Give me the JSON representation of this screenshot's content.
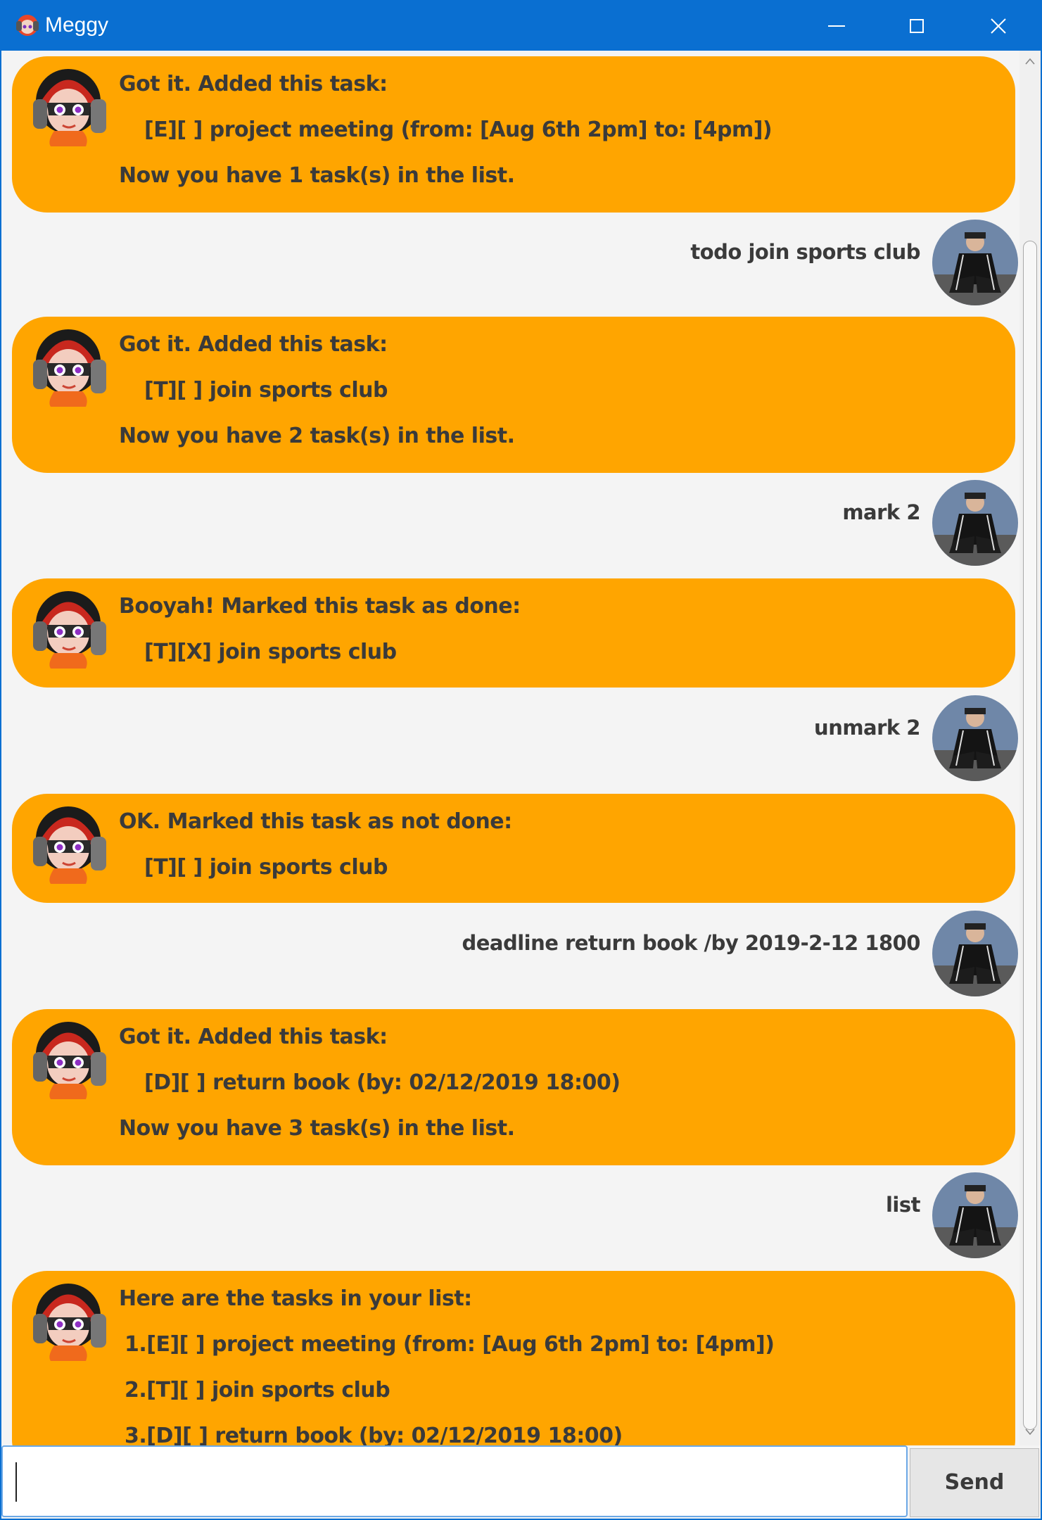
{
  "window": {
    "title": "Meggy"
  },
  "colors": {
    "titlebar": "#0a6fd1",
    "bot_bubble": "#ffa500",
    "background": "#f4f4f4",
    "text": "#3a3a3a"
  },
  "messages": [
    {
      "sender": "bot",
      "lines": [
        "Got it. Added this task:",
        "[E][ ] project meeting (from: [Aug 6th 2pm] to: [4pm])",
        "Now you have 1 task(s) in the list."
      ]
    },
    {
      "sender": "user",
      "text": "todo join sports club"
    },
    {
      "sender": "bot",
      "lines": [
        "Got it. Added this task:",
        "[T][ ] join sports club",
        "Now you have 2 task(s) in the list."
      ]
    },
    {
      "sender": "user",
      "text": "mark 2"
    },
    {
      "sender": "bot",
      "lines": [
        "Booyah! Marked this task as done:",
        "[T][X] join sports club"
      ]
    },
    {
      "sender": "user",
      "text": "unmark 2"
    },
    {
      "sender": "bot",
      "lines": [
        "OK. Marked this task as not done:",
        "[T][ ] join sports club"
      ]
    },
    {
      "sender": "user",
      "text": "deadline return book /by 2019-2-12 1800"
    },
    {
      "sender": "bot",
      "lines": [
        "Got it. Added this task:",
        "[D][ ] return book (by: 02/12/2019 18:00)",
        "Now you have 3 task(s) in the list."
      ]
    },
    {
      "sender": "user",
      "text": "list"
    },
    {
      "sender": "bot",
      "lines": [
        "Here are the tasks in your list:",
        "1.[E][ ] project meeting (from: [Aug 6th 2pm] to: [4pm])",
        "2.[T][ ] join sports club",
        "3.[D][ ] return book (by: 02/12/2019 18:00)"
      ]
    }
  ],
  "input": {
    "value": "",
    "send_label": "Send"
  }
}
